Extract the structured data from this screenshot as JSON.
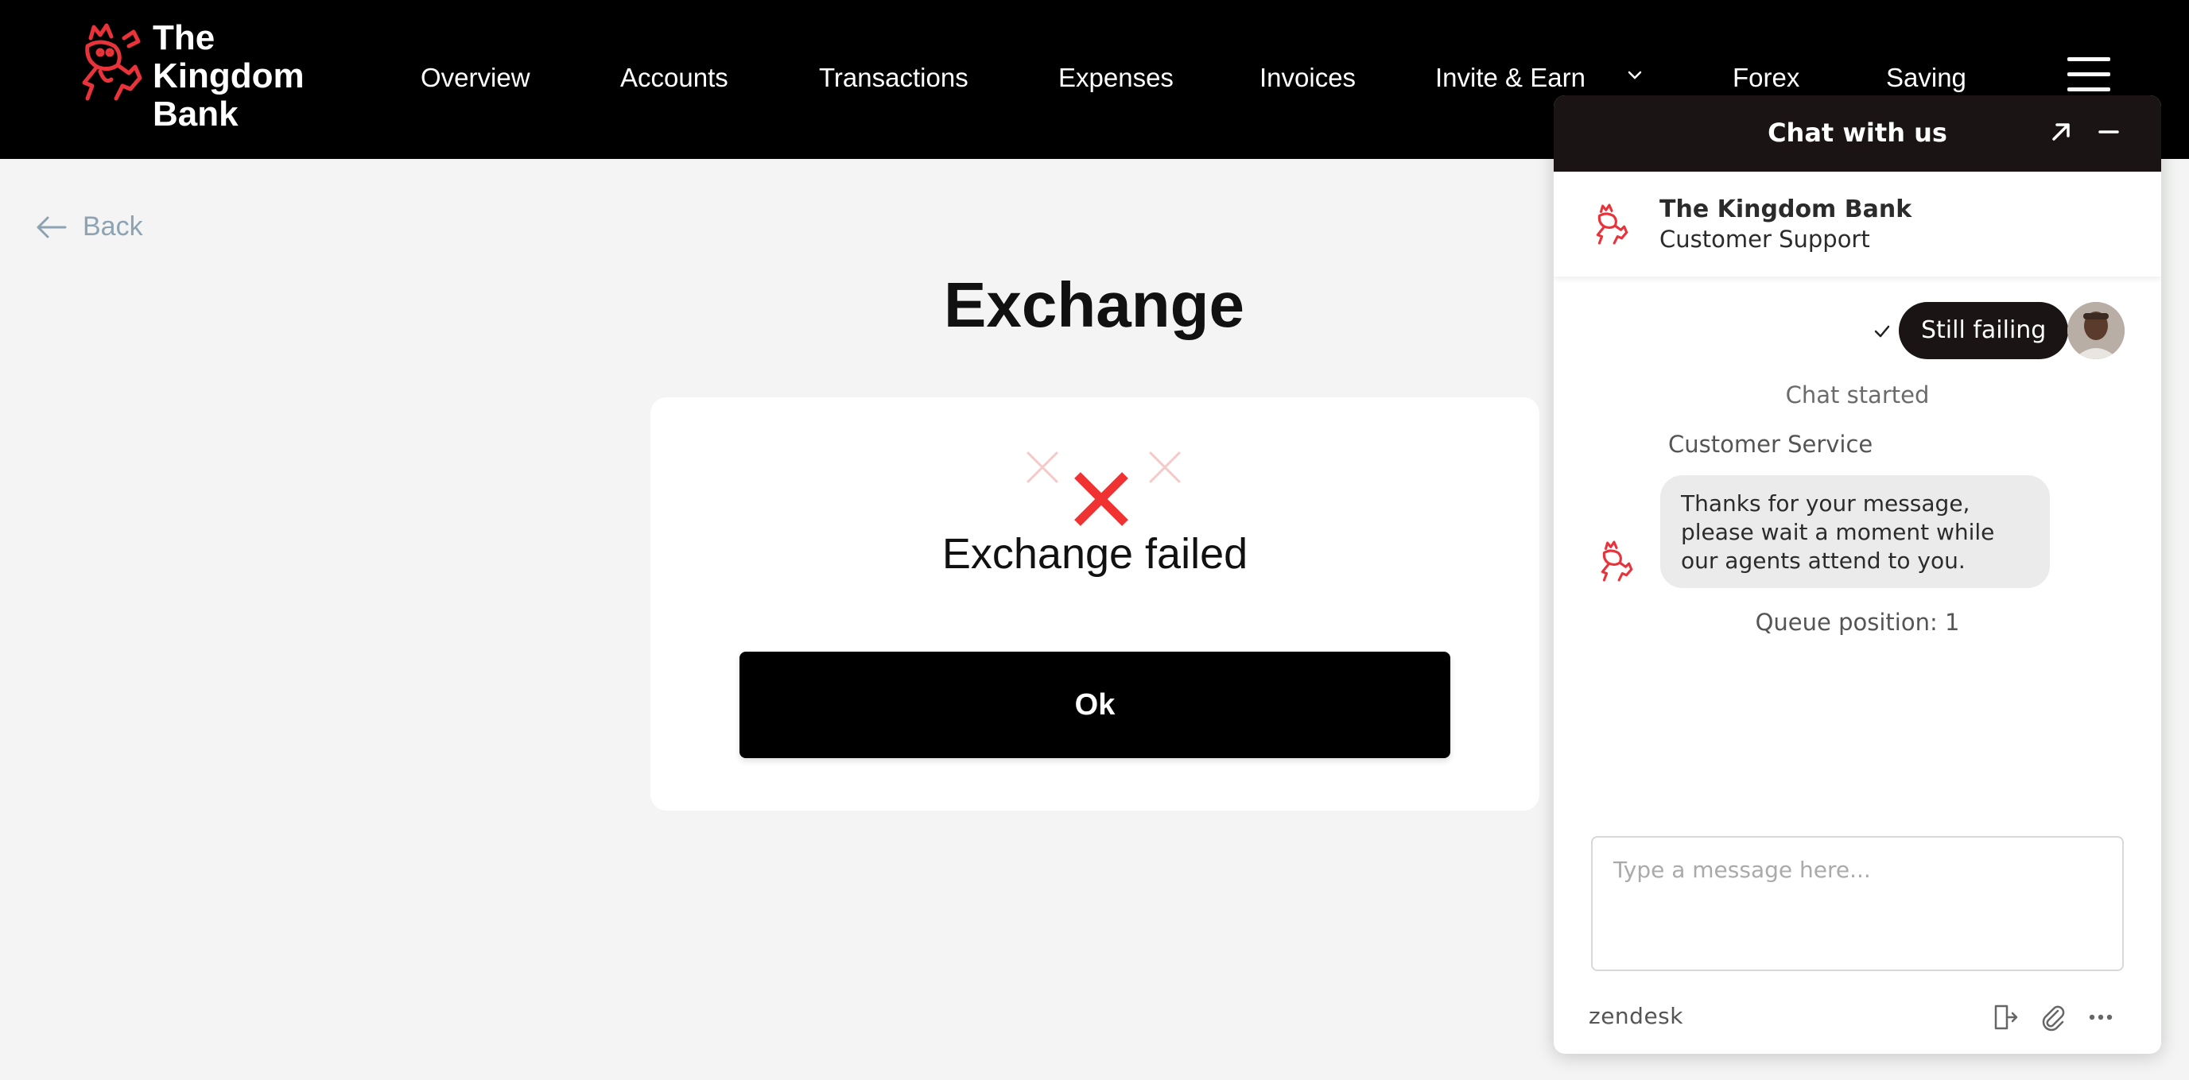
{
  "brand": {
    "name_lines": [
      "The",
      "Kingdom",
      "Bank"
    ],
    "accent": "#e8333a"
  },
  "nav": {
    "items": [
      "Overview",
      "Accounts",
      "Transactions",
      "Expenses",
      "Invoices",
      "Invite & Earn",
      "Forex",
      "Saving"
    ],
    "dropdown_icon": "chevron-down-icon",
    "menu_icon": "hamburger-icon"
  },
  "back_label": "Back",
  "page_title": "Exchange",
  "result": {
    "icon": "error-x-icon",
    "message": "Exchange failed",
    "ok_label": "Ok",
    "color": "#f03232"
  },
  "chat": {
    "title": "Chat with us",
    "agent": {
      "name": "The Kingdom Bank",
      "role": "Customer Support"
    },
    "messages": {
      "user": "Still failing",
      "system_started": "Chat started",
      "agent_label": "Customer Service",
      "agent_reply": "Thanks for your message, please wait a moment while our agents attend to you.",
      "queue": "Queue position: 1"
    },
    "input_placeholder": "Type a message here...",
    "footer_brand": "zendesk"
  }
}
